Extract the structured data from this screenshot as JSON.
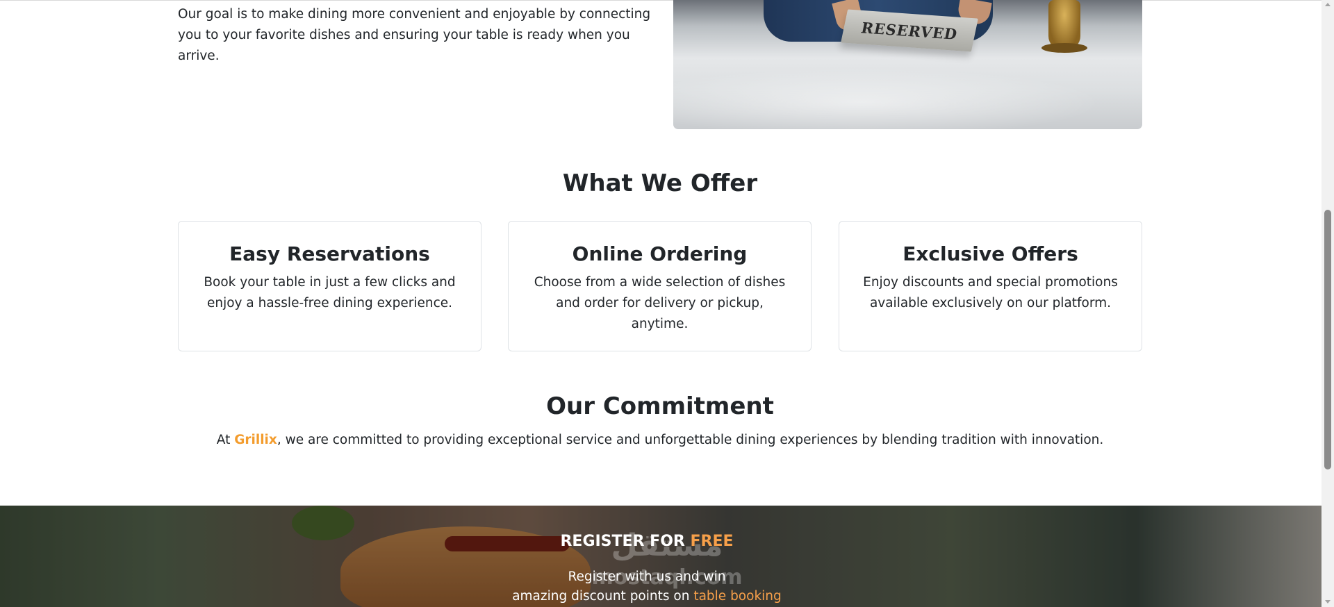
{
  "about": {
    "text": "Our goal is to make dining more convenient and enjoyable by connecting you to your favorite dishes and ensuring your table is ready when you arrive.",
    "image_sign_text": "RESERVED"
  },
  "offer": {
    "title": "What We Offer",
    "cards": [
      {
        "title": "Easy Reservations",
        "text": "Book your table in just a few clicks and enjoy a hassle-free dining experience."
      },
      {
        "title": "Online Ordering",
        "text": "Choose from a wide selection of dishes and order for delivery or pickup, anytime."
      },
      {
        "title": "Exclusive Offers",
        "text": "Enjoy discounts and special promotions available exclusively on our platform."
      }
    ]
  },
  "commitment": {
    "title": "Our Commitment",
    "prefix": "At ",
    "brand": "Grillix",
    "suffix": ", we are committed to providing exceptional service and unforgettable dining experiences by blending tradition with innovation."
  },
  "banner": {
    "title_main": "REGISTER FOR ",
    "title_accent": "FREE",
    "line1": "Register with us and win",
    "line2_prefix": "amazing discount points on ",
    "line2_link": "table booking",
    "watermark_top": "مستقل",
    "watermark_bottom": "mostaql.com"
  },
  "colors": {
    "accent": "#f39c2d",
    "text": "#212529",
    "card_border": "#dee2e6"
  }
}
